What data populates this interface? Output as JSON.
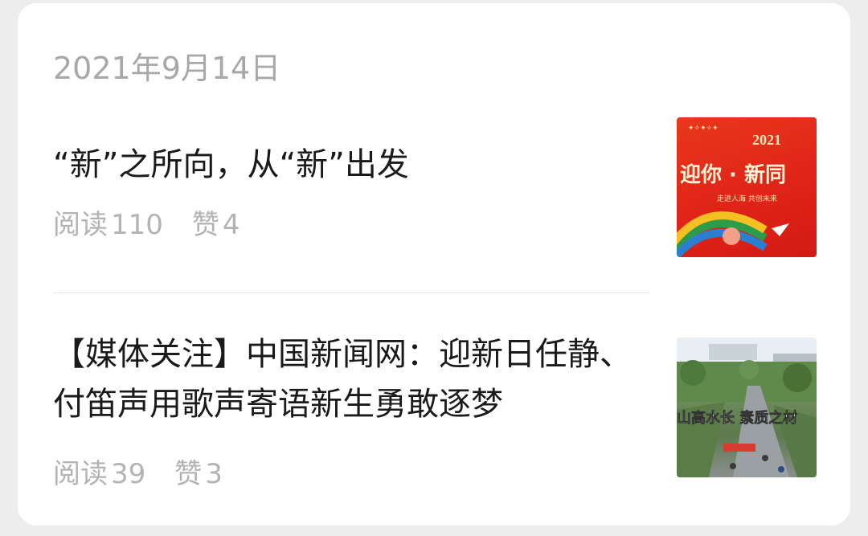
{
  "date": "2021年9月14日",
  "articles": [
    {
      "title": "“新”之所向，从“新”出发",
      "read_label": "阅读",
      "read_count": "110",
      "like_label": "赞",
      "like_count": "4",
      "thumb": {
        "header_text": "2021",
        "banner_text": "迎你 · 新同",
        "sub_text": "走进人海  共创未来"
      }
    },
    {
      "title": "【媒体关注】中国新闻网：迎新日任静、付笛声用歌声寄语新生勇敢逐梦",
      "read_label": "阅读",
      "read_count": "39",
      "like_label": "赞",
      "like_count": "3",
      "thumb": {
        "overlay_text": "山高水长 素质之材"
      }
    }
  ]
}
